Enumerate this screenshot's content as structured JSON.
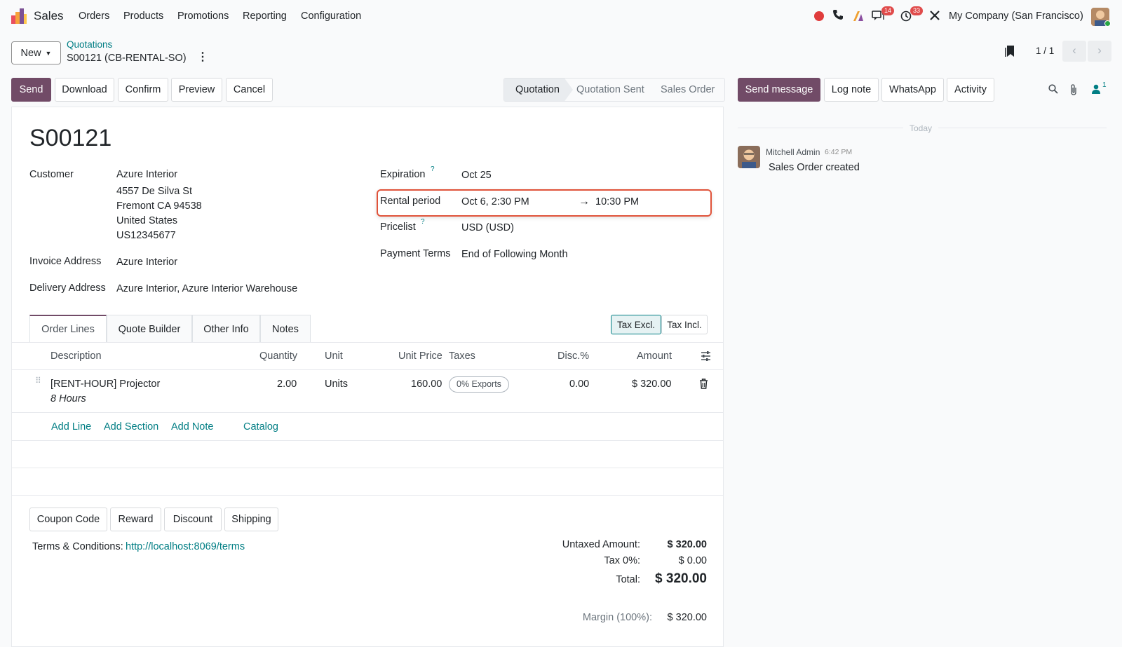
{
  "navbar": {
    "app_name": "Sales",
    "menu": [
      "Orders",
      "Products",
      "Promotions",
      "Reporting",
      "Configuration"
    ],
    "messages_count": "14",
    "activity_count": "33",
    "company": "My Company (San Francisco)"
  },
  "control": {
    "new_label": "New",
    "breadcrumb_parent": "Quotations",
    "record_name": "S00121 (CB-RENTAL-SO)",
    "pager": "1 / 1"
  },
  "actions": {
    "send": "Send",
    "download": "Download",
    "confirm": "Confirm",
    "preview": "Preview",
    "cancel": "Cancel"
  },
  "status": {
    "steps": [
      "Quotation",
      "Quotation Sent",
      "Sales Order"
    ],
    "active": "Quotation"
  },
  "form": {
    "title": "S00121",
    "customer_label": "Customer",
    "customer_lines": [
      "Azure Interior",
      "4557 De Silva St",
      "Fremont CA 94538",
      "United States",
      "US12345677"
    ],
    "invoice_label": "Invoice Address",
    "invoice_value": "Azure Interior",
    "delivery_label": "Delivery Address",
    "delivery_value": "Azure Interior, Azure Interior Warehouse",
    "expiration_label": "Expiration",
    "expiration_value": "Oct 25",
    "rental_label": "Rental period",
    "rental_start": "Oct 6, 2:30 PM",
    "rental_end": "10:30 PM",
    "pricelist_label": "Pricelist",
    "pricelist_value": "USD (USD)",
    "terms_label": "Payment Terms",
    "terms_value": "End of Following Month",
    "help_mark": "?"
  },
  "tabs": [
    "Order Lines",
    "Quote Builder",
    "Other Info",
    "Notes"
  ],
  "tax_toggle": {
    "excl": "Tax Excl.",
    "incl": "Tax Incl."
  },
  "table": {
    "headers": {
      "description": "Description",
      "quantity": "Quantity",
      "unit": "Unit",
      "unit_price": "Unit Price",
      "taxes": "Taxes",
      "disc": "Disc.%",
      "amount": "Amount"
    },
    "row": {
      "product": "[RENT-HOUR] Projector",
      "detail": "8 Hours",
      "quantity": "2.00",
      "unit": "Units",
      "unit_price": "160.00",
      "tax": "0% Exports",
      "disc": "0.00",
      "amount": "$ 320.00"
    },
    "add_line": "Add Line",
    "add_section": "Add Section",
    "add_note": "Add Note",
    "catalog": "Catalog"
  },
  "promo_buttons": {
    "coupon": "Coupon Code",
    "reward": "Reward",
    "discount": "Discount",
    "shipping": "Shipping"
  },
  "terms": {
    "label": "Terms & Conditions:",
    "url": "http://localhost:8069/terms"
  },
  "totals": {
    "untaxed_label": "Untaxed Amount:",
    "untaxed_value": "$ 320.00",
    "tax_label": "Tax 0%:",
    "tax_value": "$ 0.00",
    "total_label": "Total:",
    "total_value": "$ 320.00",
    "margin_label": "Margin (100%):",
    "margin_value": "$ 320.00"
  },
  "chatter": {
    "send_message": "Send message",
    "log_note": "Log note",
    "whatsapp": "WhatsApp",
    "activity": "Activity",
    "followers_count": "1",
    "day_separator": "Today",
    "author": "Mitchell Admin",
    "time": "6:42 PM",
    "message": "Sales Order created"
  },
  "colors": {
    "primary": "#714b67",
    "link": "#017e84",
    "highlight": "#e0533a",
    "badge": "#e04b4b"
  }
}
